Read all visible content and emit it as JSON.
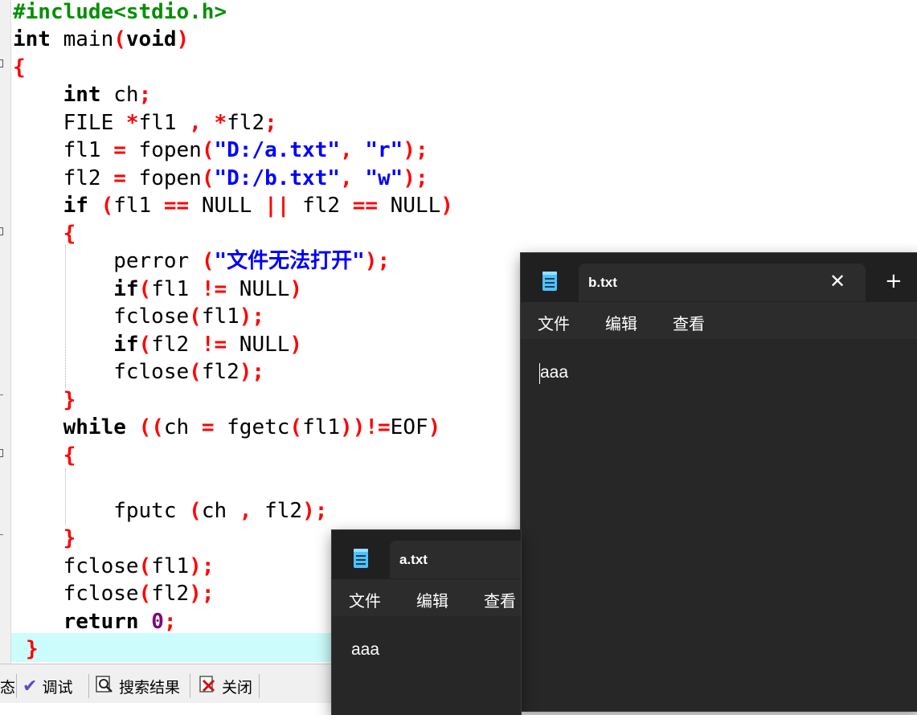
{
  "editor": {
    "lines": [
      "#include<stdio.h>",
      "int main(void)",
      "{",
      "int ch;",
      "FILE *fl1 , *fl2;",
      "fl1 = fopen(\"D:/a.txt\", \"r\");",
      "fl2 = fopen(\"D:/b.txt\", \"w\");",
      "if (fl1 == NULL || fl2 == NULL)",
      "{",
      "perror (\"文件无法打开\");",
      "if(fl1 != NULL)",
      "fclose(fl1);",
      "if(fl2 != NULL)",
      "fclose(fl2);",
      "}",
      "while ((ch = fgetc(fl1))!=EOF)",
      "{",
      "",
      "fputc (ch , fl2);",
      "}",
      "fclose(fl1);",
      "fclose(fl2);",
      "return 0;",
      "}"
    ]
  },
  "statusbar": {
    "tabs": [
      {
        "label": "态"
      },
      {
        "label": "调试"
      },
      {
        "label": "搜索结果"
      },
      {
        "label": "关闭"
      }
    ]
  },
  "notepad_b": {
    "tab_title": "b.txt",
    "menu": [
      "文件",
      "编辑",
      "查看"
    ],
    "content": "aaa"
  },
  "notepad_a": {
    "tab_title": "a.txt",
    "menu": [
      "文件",
      "编辑",
      "查看"
    ],
    "content": "aaa"
  },
  "colors": {
    "keyword": "#000000",
    "preprocessor": "#009000",
    "punctuation": "#ff0000",
    "string": "#0000ff",
    "number": "#800080",
    "current_line": "#ccfcfc",
    "notepad_bg": "#272727",
    "notepad_menubar": "#2c2c2c"
  }
}
